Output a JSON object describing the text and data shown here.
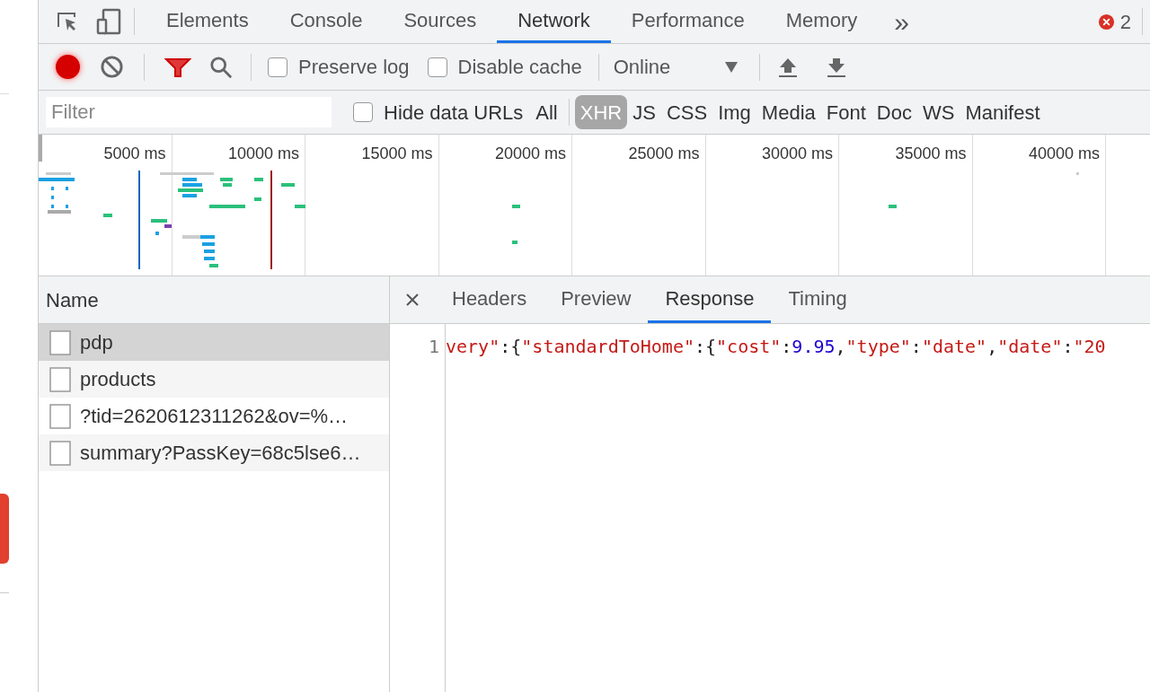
{
  "main_tabs": [
    {
      "label": "Elements",
      "selected": false
    },
    {
      "label": "Console",
      "selected": false
    },
    {
      "label": "Sources",
      "selected": false
    },
    {
      "label": "Network",
      "selected": true
    },
    {
      "label": "Performance",
      "selected": false
    },
    {
      "label": "Memory",
      "selected": false
    }
  ],
  "more_tabs": "»",
  "error_count": "2",
  "toolbar": {
    "recording": true,
    "preserve_log": {
      "label": "Preserve log",
      "checked": false
    },
    "disable_cache": {
      "label": "Disable cache",
      "checked": false
    },
    "throttling": "Online"
  },
  "filter": {
    "placeholder": "Filter",
    "hide_data_urls": {
      "label": "Hide data URLs",
      "checked": false
    },
    "types": [
      {
        "label": "All",
        "selected": false
      },
      {
        "label": "XHR",
        "selected": true
      },
      {
        "label": "JS",
        "selected": false
      },
      {
        "label": "CSS",
        "selected": false
      },
      {
        "label": "Img",
        "selected": false
      },
      {
        "label": "Media",
        "selected": false
      },
      {
        "label": "Font",
        "selected": false
      },
      {
        "label": "Doc",
        "selected": false
      },
      {
        "label": "WS",
        "selected": false
      },
      {
        "label": "Manifest",
        "selected": false
      }
    ]
  },
  "overview": {
    "ticks": [
      "5000 ms",
      "10000 ms",
      "15000 ms",
      "20000 ms",
      "25000 ms",
      "30000 ms",
      "35000 ms",
      "40000 ms"
    ]
  },
  "requests": {
    "column": "Name",
    "rows": [
      {
        "name": "pdp",
        "selected": true
      },
      {
        "name": "products",
        "selected": false
      },
      {
        "name": "?tid=2620612311262&ov=%…",
        "selected": false
      },
      {
        "name": "summary?PassKey=68c5lse6…",
        "selected": false
      }
    ]
  },
  "detail_tabs": [
    {
      "label": "Headers",
      "selected": false
    },
    {
      "label": "Preview",
      "selected": false
    },
    {
      "label": "Response",
      "selected": true
    },
    {
      "label": "Timing",
      "selected": false
    }
  ],
  "response": {
    "line_number": "1",
    "tokens": [
      {
        "kind": "string",
        "text": "very\""
      },
      {
        "kind": "punct",
        "text": ":{"
      },
      {
        "kind": "string",
        "text": "\"standardToHome\""
      },
      {
        "kind": "punct",
        "text": ":{"
      },
      {
        "kind": "string",
        "text": "\"cost\""
      },
      {
        "kind": "punct",
        "text": ":"
      },
      {
        "kind": "number",
        "text": "9.95"
      },
      {
        "kind": "punct",
        "text": ","
      },
      {
        "kind": "string",
        "text": "\"type\""
      },
      {
        "kind": "punct",
        "text": ":"
      },
      {
        "kind": "string",
        "text": "\"date\""
      },
      {
        "kind": "punct",
        "text": ","
      },
      {
        "kind": "string",
        "text": "\"date\""
      },
      {
        "kind": "punct",
        "text": ":"
      },
      {
        "kind": "string",
        "text": "\"20"
      }
    ]
  }
}
